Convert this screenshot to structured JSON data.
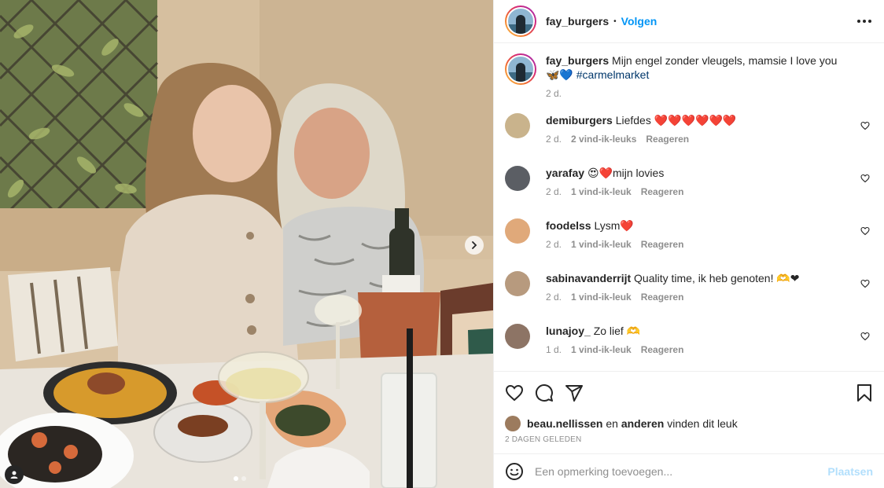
{
  "header": {
    "username": "fay_burgers",
    "separator": "•",
    "follow_label": "Volgen"
  },
  "caption": {
    "username": "fay_burgers",
    "text": "Mijn engel zonder vleugels, mamsie I love you 🦋💙",
    "hashtag": "#carmelmarket",
    "time": "2 d."
  },
  "comments": [
    {
      "username": "demiburgers",
      "text": "Liefdes ❤️❤️❤️❤️❤️❤️",
      "time": "2 d.",
      "likes": "2 vind-ik-leuks",
      "reply": "Reageren",
      "avatar_color": "#c9b38c"
    },
    {
      "username": "yarafay",
      "text": "😍❤️mijn lovies",
      "time": "2 d.",
      "likes": "1 vind-ik-leuk",
      "reply": "Reageren",
      "avatar_color": "#5b5e64"
    },
    {
      "username": "foodelss",
      "text": "Lysm❤️",
      "time": "2 d.",
      "likes": "1 vind-ik-leuk",
      "reply": "Reageren",
      "avatar_color": "#e0a97a"
    },
    {
      "username": "sabinavanderrijt",
      "text": "Quality time, ik heb genoten! 🫶❤",
      "time": "2 d.",
      "likes": "1 vind-ik-leuk",
      "reply": "Reageren",
      "avatar_color": "#b79a7e"
    },
    {
      "username": "lunajoy_",
      "text": "Zo lief 🫶",
      "time": "1 d.",
      "likes": "1 vind-ik-leuk",
      "reply": "Reageren",
      "avatar_color": "#8d7465"
    }
  ],
  "likes": {
    "first_user": "beau.nellissen",
    "connector": "en",
    "others": "anderen",
    "suffix": "vinden dit leuk"
  },
  "post_date": "2 DAGEN GELEDEN",
  "add_comment": {
    "placeholder": "Een opmerking toevoegen...",
    "post_label": "Plaatsen"
  },
  "carousel": {
    "slides": 2,
    "active": 1
  },
  "colors": {
    "accent": "#0095f6",
    "text": "#262626",
    "muted": "#8e8e8e",
    "border": "#efefef",
    "post_disabled": "#b2dffc"
  },
  "icons": [
    "more-icon",
    "heart-icon",
    "comment-icon",
    "share-icon",
    "bookmark-icon",
    "emoji-icon",
    "chevron-right-icon",
    "user-tag-icon"
  ]
}
